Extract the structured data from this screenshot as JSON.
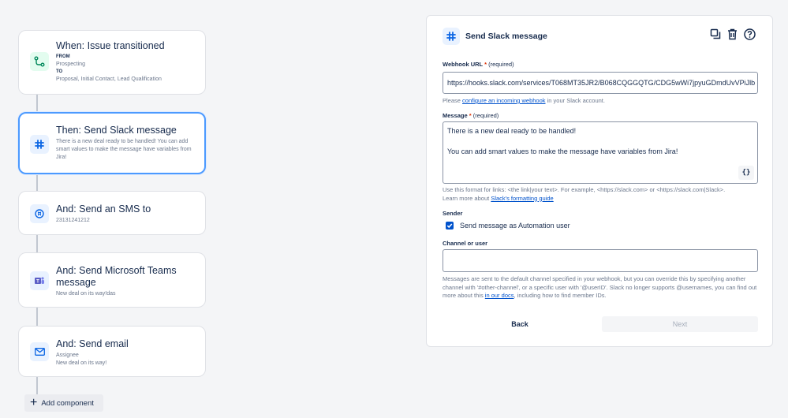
{
  "flow": {
    "trigger": {
      "title": "When: Issue transitioned",
      "from_label": "FROM",
      "from_value": "Prospecting",
      "to_label": "TO",
      "to_value": "Proposal, Initial Contact, Lead Qualification"
    },
    "slack": {
      "title": "Then: Send Slack message",
      "desc": "There is a new deal ready to be handled! You can add smart values to make the message have variables from Jira!"
    },
    "sms": {
      "title": "And: Send an SMS to",
      "desc": "23131241212"
    },
    "teams": {
      "title": "And: Send Microsoft Teams message",
      "desc": "New deal on its way!das"
    },
    "email": {
      "title": "And: Send email",
      "line1": "Assignee",
      "line2": "New deal on its way!"
    },
    "add_label": "Add component"
  },
  "panel": {
    "title": "Send Slack message",
    "webhook": {
      "label": "Webhook URL",
      "required_marker": "*",
      "required_text": "(required)",
      "value": "https://hooks.slack.com/services/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",
      "help_prefix": "Please",
      "help_link": "configure an incoming webhook",
      "help_suffix": "in your Slack account."
    },
    "message": {
      "label": "Message",
      "required_marker": "*",
      "required_text": "(required)",
      "line1": "There is a new deal ready to be handled!",
      "line2": "You can add smart values to make the message have variables from Jira!",
      "braces": "{}",
      "help_line1": "Use this format for links: <the link|your text>. For example, <https://slack.com> or <https://slack.com|Slack>.",
      "help_line2_prefix": "Learn more about",
      "help_line2_link": "Slack's formatting guide"
    },
    "sender": {
      "label": "Sender",
      "checkbox_label": "Send message as Automation user"
    },
    "channel": {
      "label": "Channel or user",
      "value": "",
      "help_part1": "Messages are sent to the default channel specified in your webhook, but you can override this by specifying another channel with '#other-channel', or a specific user with '@userID'. Slack no longer supports @usernames, you can find out more about this",
      "help_link": "in our docs",
      "help_part2": ", including how to find member IDs."
    },
    "back_label": "Back",
    "next_label": "Next"
  },
  "colors": {
    "accent": "#0052cc",
    "selected_border": "#4c9aff",
    "trigger_icon_bg": "#e3fcef",
    "action_icon_bg": "#e9f2ff"
  }
}
